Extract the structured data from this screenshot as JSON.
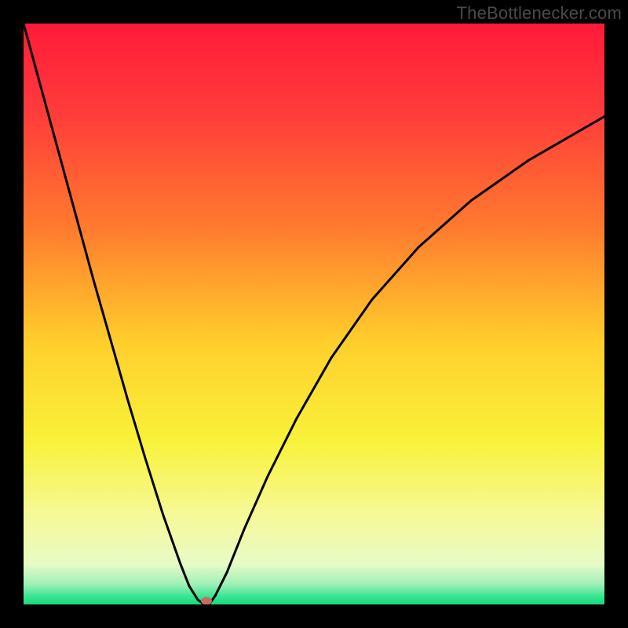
{
  "watermark": "TheBottlenecker.com",
  "chart_data": {
    "type": "line",
    "title": "",
    "xlabel": "",
    "ylabel": "",
    "xlim": [
      0,
      100
    ],
    "ylim": [
      0,
      100
    ],
    "background_gradient": {
      "stops": [
        {
          "offset": 0.0,
          "color": "#ff1a3a"
        },
        {
          "offset": 0.15,
          "color": "#ff3b3b"
        },
        {
          "offset": 0.35,
          "color": "#ff7a2e"
        },
        {
          "offset": 0.55,
          "color": "#ffcf2c"
        },
        {
          "offset": 0.72,
          "color": "#f8f23a"
        },
        {
          "offset": 0.85,
          "color": "#f6f99a"
        },
        {
          "offset": 0.93,
          "color": "#e8fbc6"
        },
        {
          "offset": 0.965,
          "color": "#9ff0b8"
        },
        {
          "offset": 0.985,
          "color": "#3ee693"
        },
        {
          "offset": 1.0,
          "color": "#14da82"
        }
      ]
    },
    "series": [
      {
        "name": "curve",
        "x": [
          0,
          3,
          6,
          9,
          12,
          15,
          18,
          21,
          24,
          27,
          28.5,
          30,
          31,
          31.5,
          32,
          33,
          35,
          38,
          42,
          47,
          53,
          60,
          68,
          77,
          87,
          100
        ],
        "y": [
          100,
          89,
          78,
          67,
          56,
          45.5,
          35,
          25,
          15.5,
          7,
          3.2,
          0.8,
          0.1,
          0,
          0.1,
          1.5,
          5.5,
          13,
          22,
          32,
          42.5,
          52.5,
          61.5,
          69.5,
          76.5,
          84
        ]
      }
    ],
    "marker": {
      "x": 31.5,
      "y": 0.6,
      "color": "#c76a5f"
    }
  }
}
